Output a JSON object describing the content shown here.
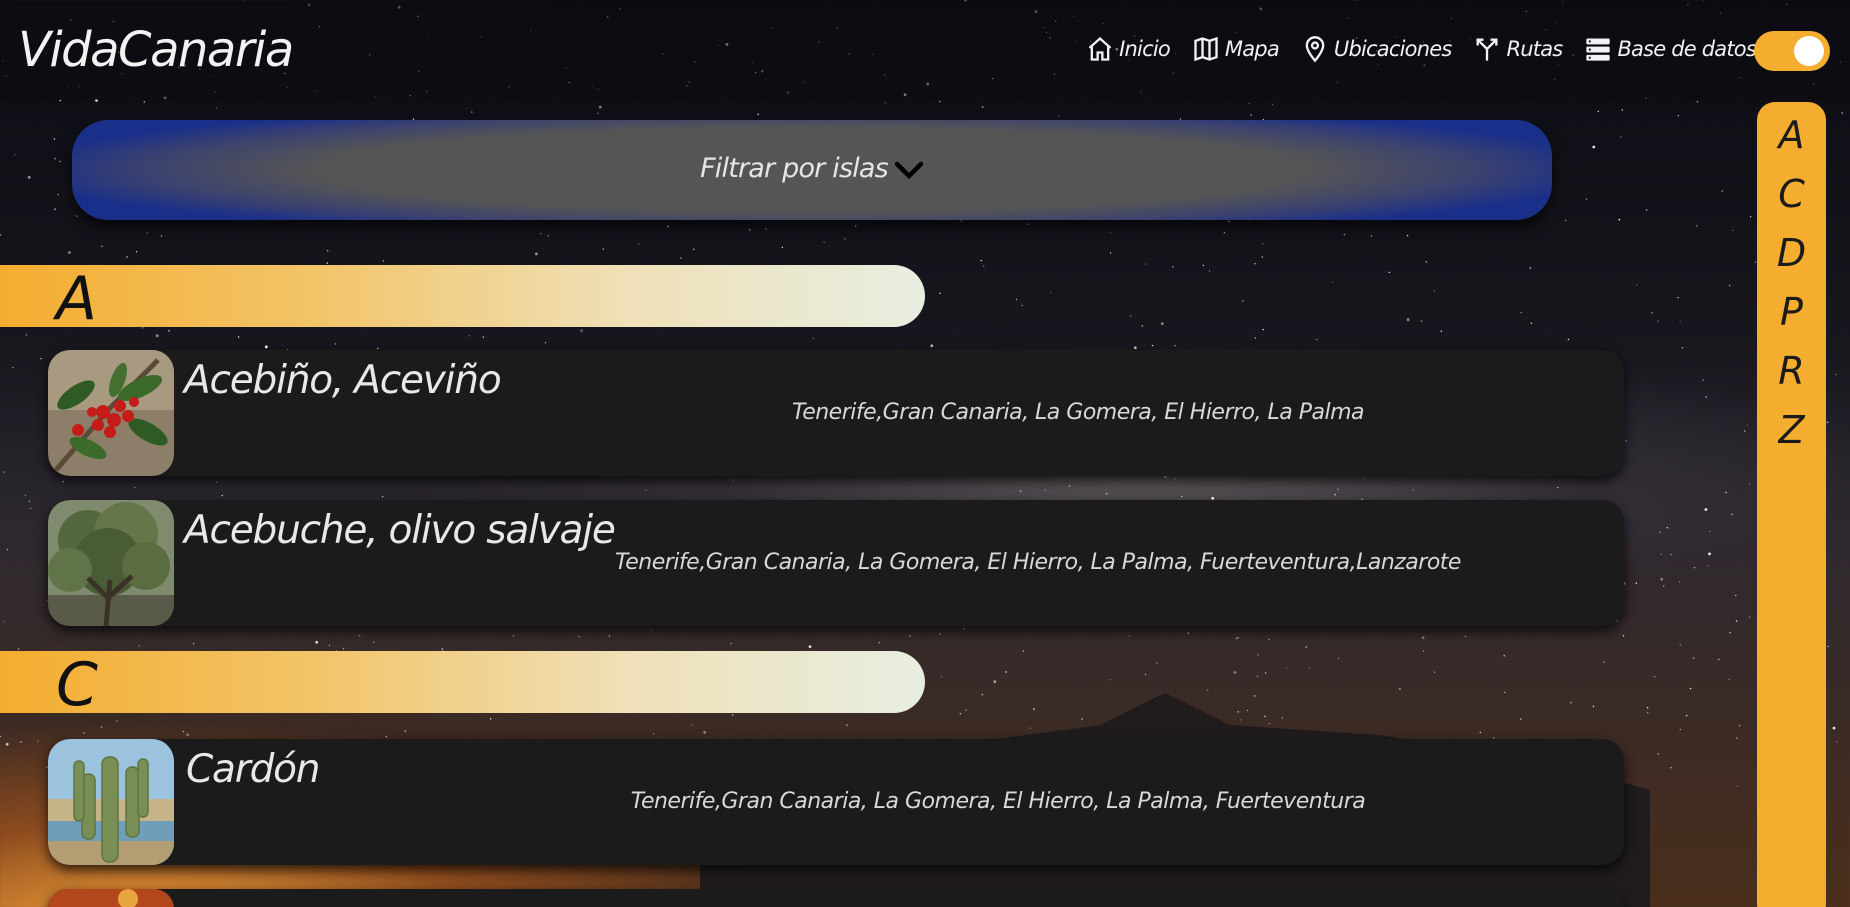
{
  "brand": "VidaCanaria",
  "nav": [
    {
      "label": "Inicio",
      "icon": "home-icon"
    },
    {
      "label": "Mapa",
      "icon": "map-icon"
    },
    {
      "label": "Ubicaciones",
      "icon": "location-pin-icon"
    },
    {
      "label": "Rutas",
      "icon": "route-fork-icon"
    },
    {
      "label": "Base de datos",
      "icon": "database-icon"
    }
  ],
  "theme_toggle": {
    "state": "on",
    "color": "#f4ad2f"
  },
  "filter": {
    "label": "Filtrar por islas",
    "icon": "chevron-down-icon"
  },
  "sections": [
    {
      "letter": "A",
      "entries": [
        {
          "name": "Acebiño, Aceviño",
          "islands": "Tenerife,Gran Canaria, La Gomera, El Hierro, La Palma",
          "image": "holly-berries-photo"
        },
        {
          "name": "Acebuche, olivo salvaje",
          "islands": "Tenerife,Gran Canaria, La Gomera, El Hierro, La Palma, Fuerteventura,Lanzarote",
          "image": "wild-olive-tree-photo"
        }
      ]
    },
    {
      "letter": "C",
      "entries": [
        {
          "name": "Cardón",
          "islands": "Tenerife,Gran Canaria, La Gomera, El Hierro, La Palma, Fuerteventura",
          "image": "cardon-cactus-photo"
        }
      ]
    }
  ],
  "alphabet_index": [
    "A",
    "C",
    "D",
    "P",
    "R",
    "Z"
  ],
  "colors": {
    "accent": "#f4ad2f",
    "card": "#1b1b1b",
    "filter_edge": "#1a2f8a"
  }
}
